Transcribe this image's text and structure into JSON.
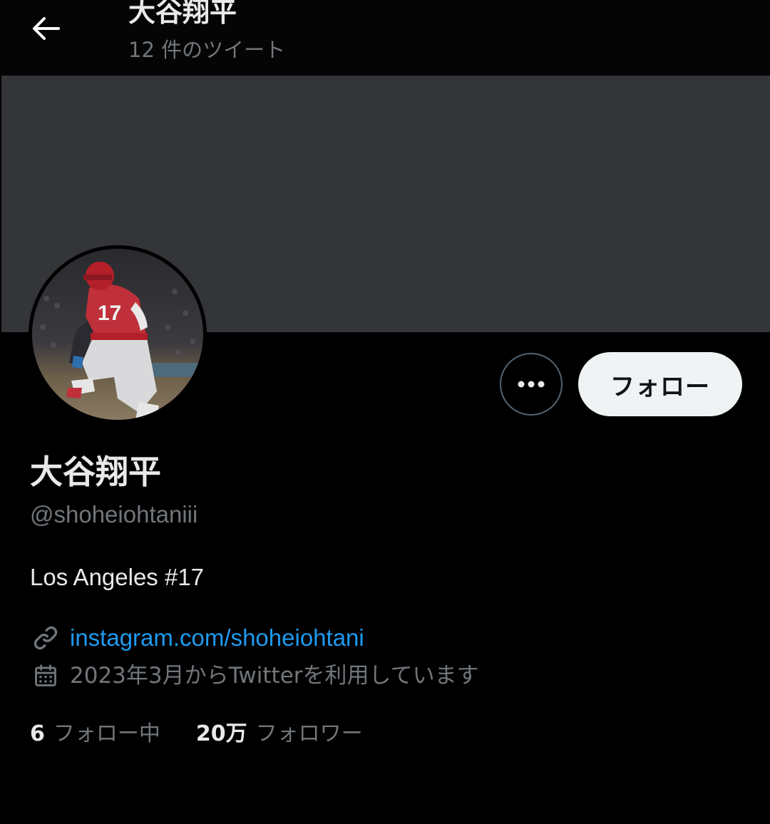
{
  "header": {
    "title": "大谷翔平",
    "subtitle": "12 件のツイート",
    "back_icon": "back-arrow-icon"
  },
  "colors": {
    "background": "#000000",
    "banner": "#333538",
    "link": "#1d9bf0",
    "secondary_text": "#71767b",
    "follow_button_bg": "#eff3f4"
  },
  "profile": {
    "name": "大谷翔平",
    "handle": "@shoheiohtaniii",
    "bio": "Los Angeles #17",
    "link": "instagram.com/shoheiohtani",
    "joined": "2023年3月からTwitterを利用しています",
    "avatar_icon": "profile-photo-baseball-player"
  },
  "actions": {
    "more_icon": "more-options-icon",
    "follow_label": "フォロー"
  },
  "stats": {
    "following_count": "6",
    "following_label": "フォロー中",
    "followers_count": "20万",
    "followers_label": "フォロワー"
  }
}
